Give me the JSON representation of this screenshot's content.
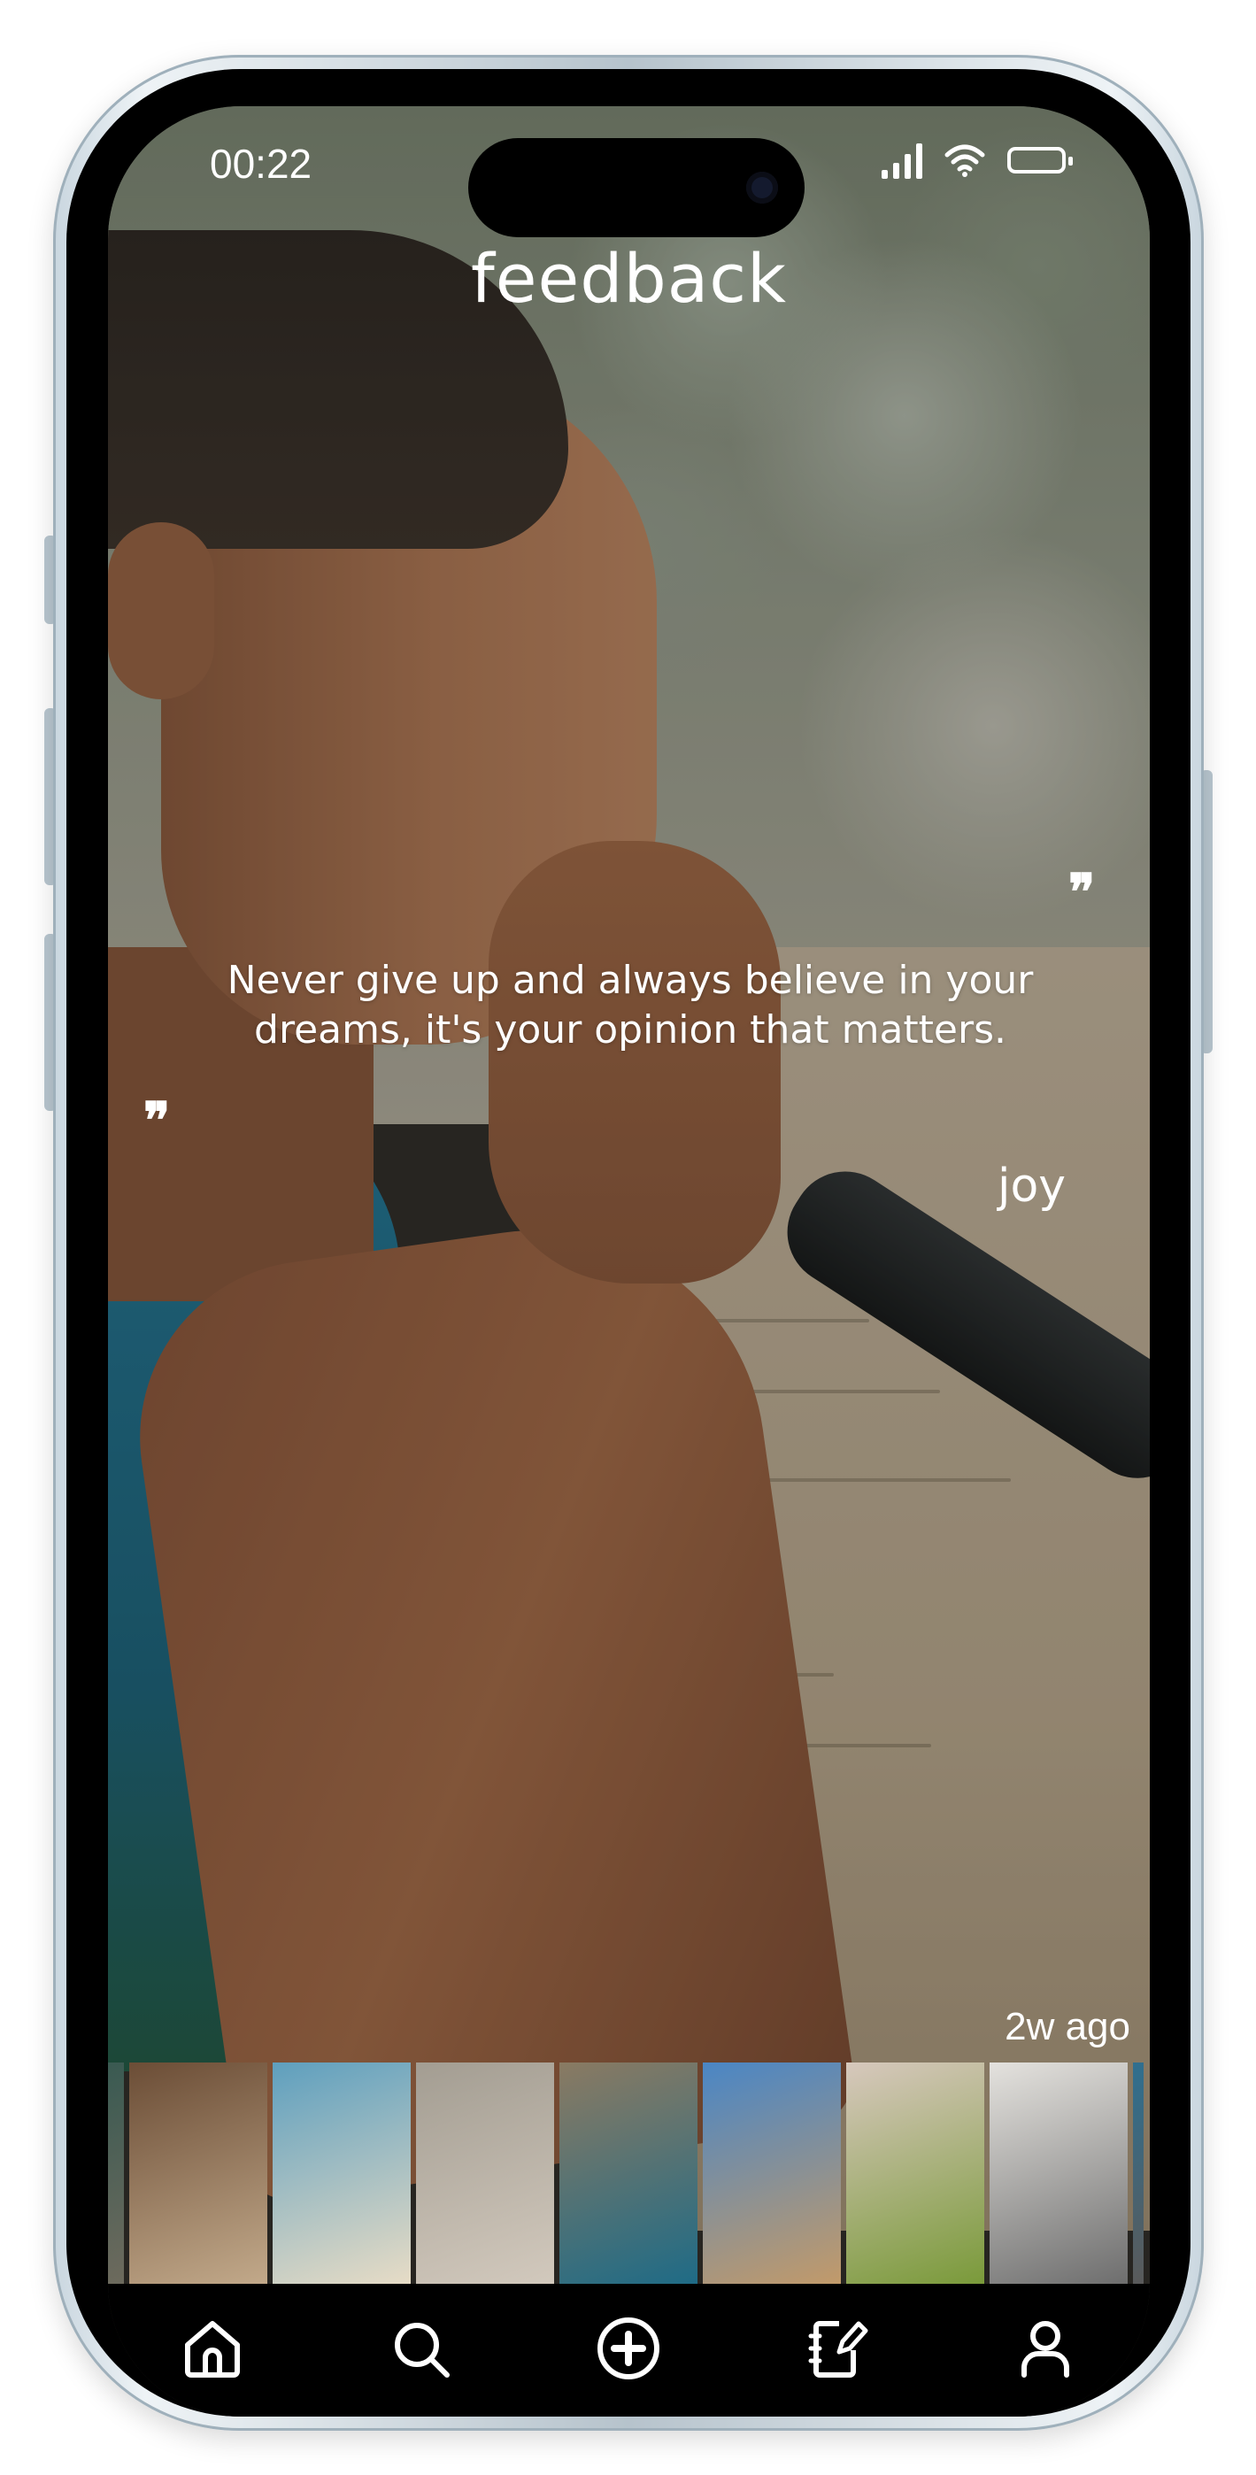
{
  "status_bar": {
    "time": "00:22",
    "icons": [
      "cellular-signal-icon",
      "wifi-icon",
      "battery-icon"
    ]
  },
  "header": {
    "title": "feedback"
  },
  "feedback": {
    "quote": "Never give up and always believe in your dreams, it's your opinion that matters.",
    "quote_mark": "❞",
    "author": "joy",
    "posted": "2w ago"
  },
  "thumbnails": [
    {
      "name": "thumb-partial",
      "colors": [
        "#3a5a52",
        "#6d6a5d"
      ]
    },
    {
      "name": "thumb-love-note",
      "colors": [
        "#6b4d36",
        "#c2a98a"
      ]
    },
    {
      "name": "thumb-beach-kids",
      "colors": [
        "#5e9fbe",
        "#e7dcc6"
      ]
    },
    {
      "name": "thumb-river-couple",
      "colors": [
        "#a39d92",
        "#d2c9bd"
      ]
    },
    {
      "name": "thumb-mic-speaker",
      "colors": [
        "#8a7a62",
        "#1f6b86"
      ]
    },
    {
      "name": "thumb-sagrada-familia",
      "colors": [
        "#4a86c5",
        "#c29a6a"
      ]
    },
    {
      "name": "thumb-apple-tape",
      "colors": [
        "#d7c8bd",
        "#7a9a3a"
      ]
    },
    {
      "name": "thumb-therapy-session",
      "colors": [
        "#e4e2de",
        "#6e6e6e"
      ]
    },
    {
      "name": "thumb-partial",
      "colors": [
        "#2f6f8f",
        "#5a5a5a"
      ]
    }
  ],
  "nav": {
    "items": [
      {
        "name": "nav-home",
        "icon": "home-icon"
      },
      {
        "name": "nav-search",
        "icon": "search-icon"
      },
      {
        "name": "nav-add",
        "icon": "plus-circle-icon"
      },
      {
        "name": "nav-journal",
        "icon": "notebook-edit-icon"
      },
      {
        "name": "nav-profile",
        "icon": "user-icon"
      }
    ]
  },
  "colors": {
    "text": "#ffffff",
    "nav_background": "#000000"
  }
}
